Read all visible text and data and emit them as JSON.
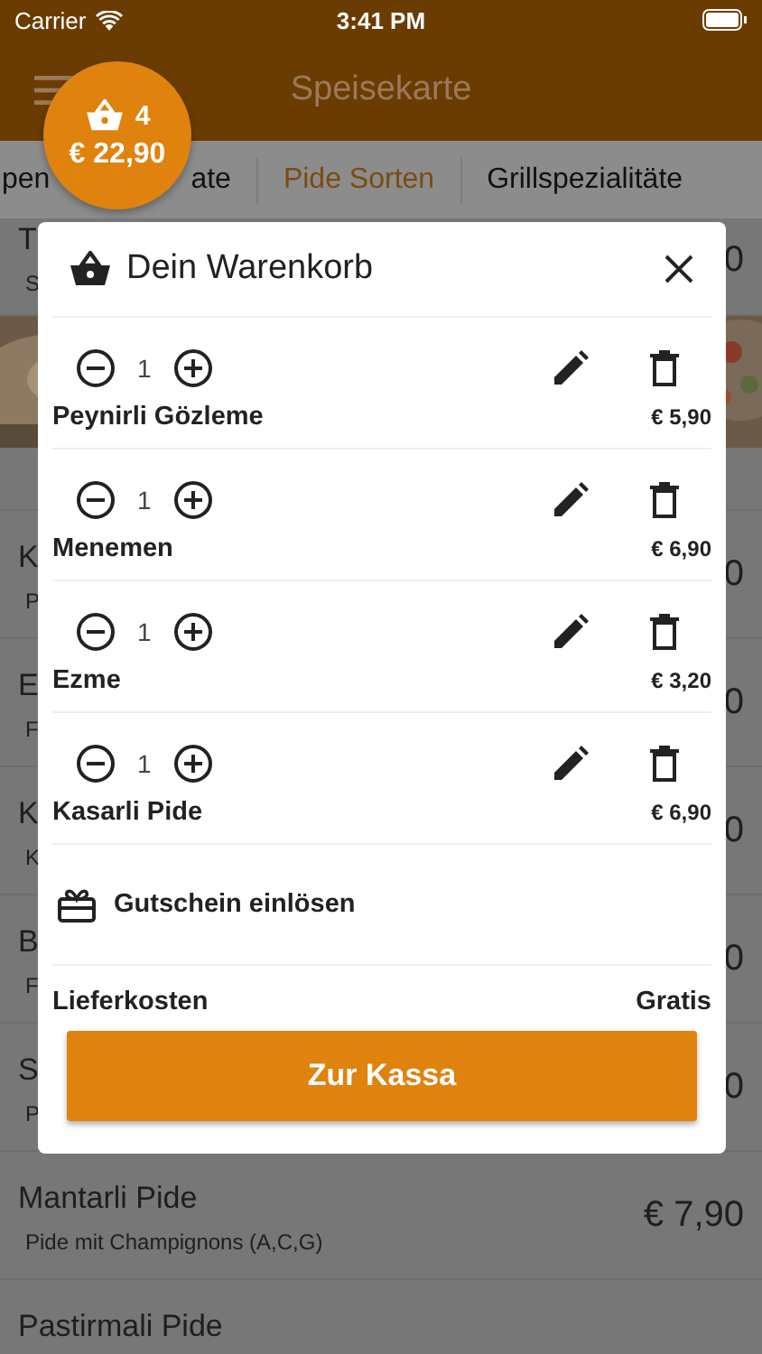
{
  "status_bar": {
    "carrier": "Carrier",
    "time": "3:41 PM"
  },
  "header": {
    "title": "Speisekarte"
  },
  "cart_badge": {
    "count": "4",
    "total": "€ 22,90"
  },
  "tabs": [
    {
      "label": "pen",
      "selected": false
    },
    {
      "label": "ate",
      "selected": false
    },
    {
      "label": "Pide Sorten",
      "selected": true
    },
    {
      "label": "Grillspezialitäte",
      "selected": false
    }
  ],
  "menu_top_row": {
    "name": "T",
    "description": "S",
    "price": "0"
  },
  "menu_rows": [
    {
      "name": "K",
      "description": "P",
      "price": "0"
    },
    {
      "name": "E",
      "description": "F",
      "price": "0"
    },
    {
      "name": "K",
      "description": "K",
      "price": "0"
    },
    {
      "name": "B",
      "description": "F",
      "price": "0"
    },
    {
      "name": "S",
      "description": "P",
      "price": "0"
    },
    {
      "name": "Mantarli Pide",
      "description": "Pide mit Champignons (A,C,G)",
      "price": "€ 7,90"
    },
    {
      "name": "Pastirmali Pide"
    }
  ],
  "cart": {
    "title": "Dein Warenkorb",
    "items": [
      {
        "quantity": "1",
        "name": "Peynirli Gözleme",
        "price": "€ 5,90"
      },
      {
        "quantity": "1",
        "name": "Menemen",
        "price": "€ 6,90"
      },
      {
        "quantity": "1",
        "name": "Ezme",
        "price": "€ 3,20"
      },
      {
        "quantity": "1",
        "name": "Kasarli Pide",
        "price": "€ 6,90"
      }
    ],
    "voucher": "Gutschein einlösen",
    "delivery_label": "Lieferkosten",
    "delivery_value": "Gratis",
    "checkout": "Zur Kassa"
  }
}
